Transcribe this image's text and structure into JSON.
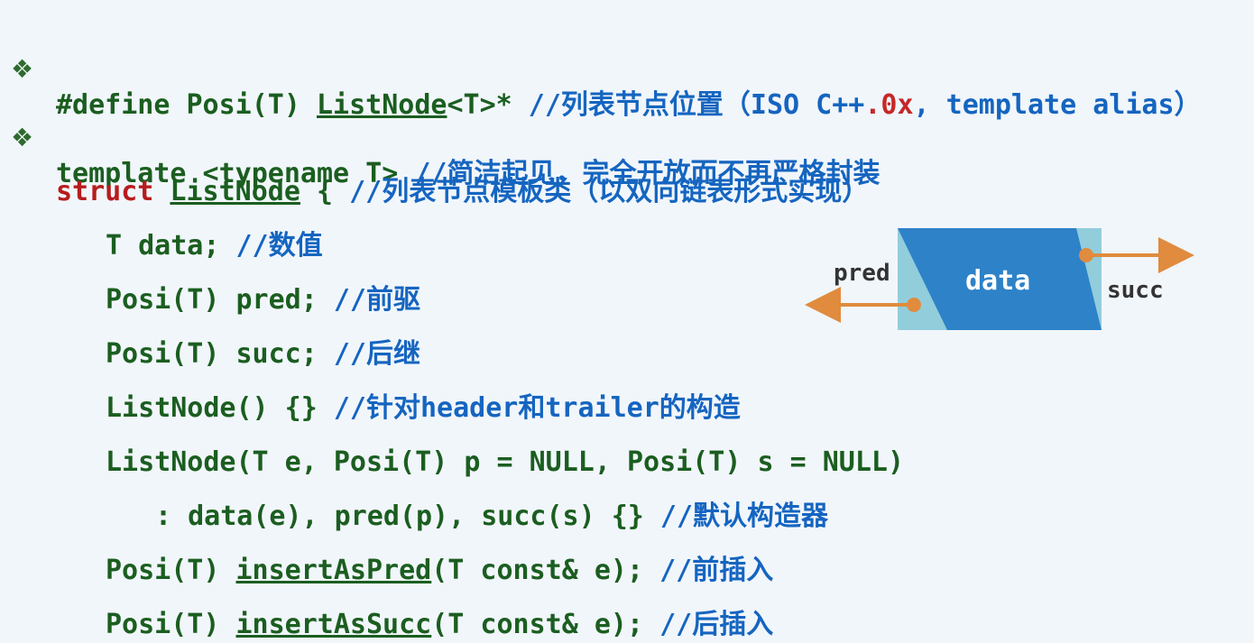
{
  "lines": {
    "l1": {
      "bullet": "❖",
      "code_a": "#define Posi(T) ",
      "code_link": "ListNode",
      "code_b": "<T>* ",
      "comment_a": "//列表节点位置（ISO C++",
      "comment_red": ".0x",
      "comment_b": ", template alias）"
    },
    "l2": {
      "bullet": "❖",
      "code": "template <typename T> ",
      "comment": "//简洁起见，完全开放而不再严格封装"
    },
    "l3": {
      "keyword": "struct ",
      "code_link": "ListNode",
      "code_b": " { ",
      "comment": "//列表节点模板类（以双向链表形式实现）"
    },
    "l4": {
      "code": "T data; ",
      "comment": "//数值"
    },
    "l5": {
      "code": "Posi(T) pred; ",
      "comment": "//前驱"
    },
    "l6": {
      "code": "Posi(T) succ; ",
      "comment": "//后继"
    },
    "l7": {
      "code": "ListNode() {} ",
      "comment": "//针对header和trailer的构造"
    },
    "l8": {
      "code": "ListNode(T e, Posi(T) p = NULL, Posi(T) s = NULL)"
    },
    "l9": {
      "code": ": data(e), pred(p), succ(s) {} ",
      "comment": "//默认构造器"
    },
    "l10": {
      "code_a": "Posi(T) ",
      "code_link": "insertAsPred",
      "code_b": "(T const& e); ",
      "comment": "//前插入"
    },
    "l11": {
      "code_a": "Posi(T) ",
      "code_link": "insertAsSucc",
      "code_b": "(T const& e); ",
      "comment": "//后插入"
    }
  },
  "diagram": {
    "pred_label": "pred",
    "data_label": "data",
    "succ_label": "succ",
    "colors": {
      "light": "#92cddc",
      "dark": "#2e82c8",
      "arrow": "#e08b3e"
    }
  }
}
